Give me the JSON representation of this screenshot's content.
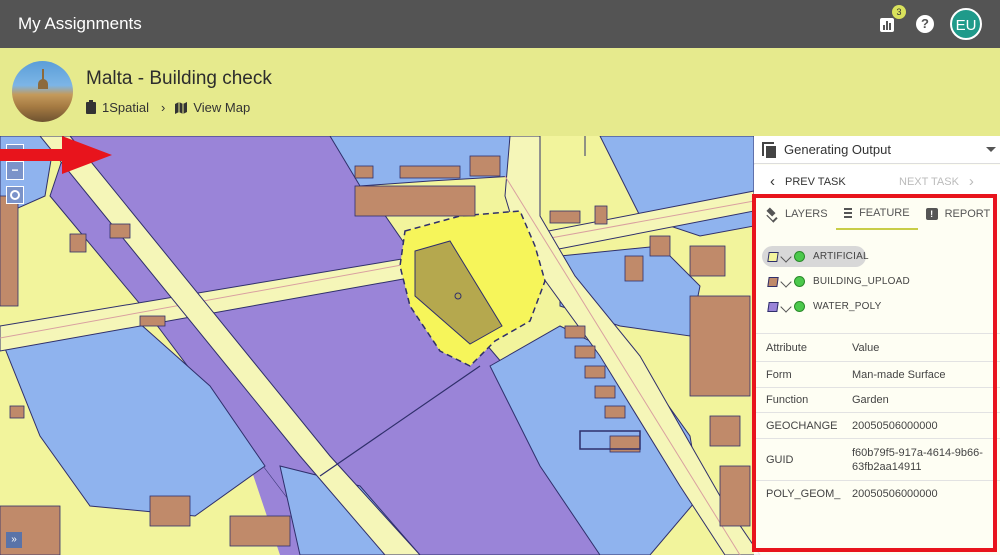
{
  "app": {
    "title": "My Assignments"
  },
  "topbar": {
    "notification_count": "3",
    "help_label": "?",
    "avatar_initials": "EU"
  },
  "project": {
    "title": "Malta - Building check",
    "breadcrumb_org": "1Spatial",
    "view_map_label": "View Map"
  },
  "map": {
    "zoom_in": "+",
    "zoom_out": "−",
    "expand": "»"
  },
  "panel": {
    "output_status": "Generating Output",
    "prev_task": "PREV TASK",
    "next_task": "NEXT TASK",
    "tabs": [
      {
        "label": "LAYERS",
        "icon": "layers-icon"
      },
      {
        "label": "FEATURE",
        "icon": "list-icon"
      },
      {
        "label": "REPORT",
        "icon": "report-icon"
      }
    ],
    "layers": [
      {
        "name": "ARTIFICIAL",
        "color": "#f4f59e"
      },
      {
        "name": "BUILDING_UPLOAD",
        "color": "#c08a6a"
      },
      {
        "name": "WATER_POLY",
        "color": "#9a84d8"
      }
    ],
    "attributes": {
      "header": {
        "key": "Attribute",
        "value": "Value"
      },
      "rows": [
        {
          "key": "Form",
          "value": "Man-made Surface"
        },
        {
          "key": "Function",
          "value": "Garden"
        },
        {
          "key": "GEOCHANGE",
          "value": "20050506000000"
        },
        {
          "key": "GUID",
          "value": "f60b79f5-917a-4614-9b66-63fb2aa14911"
        },
        {
          "key": "POLY_GEOM_",
          "value": "20050506000000"
        }
      ]
    }
  },
  "colors": {
    "topbar": "#545454",
    "header": "#e6ea8d",
    "water": "#9a84d8",
    "land": "#f2f49c",
    "building": "#c08a6a",
    "highlight": "#e8141c",
    "status_dot": "#4cc94c"
  }
}
